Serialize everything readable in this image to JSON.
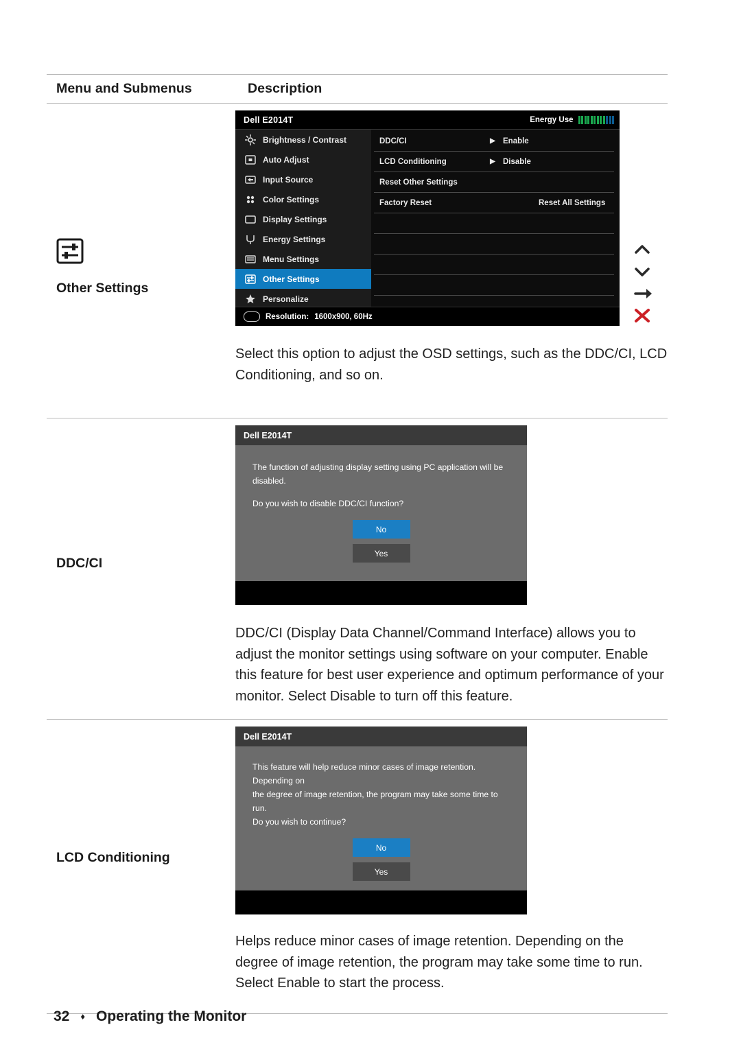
{
  "table": {
    "header": {
      "menu_col": "Menu and Submenus",
      "desc_col": "Description"
    },
    "rows": [
      {
        "label": "Other Settings",
        "description": "Select this option to adjust the OSD settings, such as the DDC/CI, LCD Conditioning, and so on."
      },
      {
        "label": "DDC/CI",
        "description": "DDC/CI (Display Data Channel/Command Interface) allows you to adjust the monitor settings using software on your computer. Enable this feature for best user experience and optimum performance of your monitor. Select Disable to turn off this feature."
      },
      {
        "label": "LCD Conditioning",
        "description": "Helps reduce minor cases of image retention. Depending on the degree of image retention, the program may take some time to run. Select Enable to start the process."
      }
    ]
  },
  "osd": {
    "model": "Dell E2014T",
    "energy_label": "Energy Use",
    "energy_bars_lit": 9,
    "energy_bars_dim": 3,
    "menu_items": [
      {
        "label": "Brightness / Contrast",
        "icon": "brightness-icon",
        "active": false
      },
      {
        "label": "Auto Adjust",
        "icon": "auto-adjust-icon",
        "active": false
      },
      {
        "label": "Input Source",
        "icon": "input-source-icon",
        "active": false
      },
      {
        "label": "Color Settings",
        "icon": "color-settings-icon",
        "active": false
      },
      {
        "label": "Display Settings",
        "icon": "display-settings-icon",
        "active": false
      },
      {
        "label": "Energy Settings",
        "icon": "energy-settings-icon",
        "active": false
      },
      {
        "label": "Menu Settings",
        "icon": "menu-settings-icon",
        "active": false
      },
      {
        "label": "Other Settings",
        "icon": "other-settings-icon",
        "active": true
      },
      {
        "label": "Personalize",
        "icon": "personalize-star-icon",
        "active": false
      }
    ],
    "options": [
      {
        "name": "DDC/CI",
        "arrow": "▶",
        "value": "Enable"
      },
      {
        "name": "LCD Conditioning",
        "arrow": "▶",
        "value": "Disable"
      },
      {
        "name": "Reset Other Settings",
        "arrow": "",
        "value": ""
      },
      {
        "name": "Factory Reset",
        "arrow": "",
        "value": "Reset All Settings"
      }
    ],
    "footer": {
      "resolution_label": "Resolution:",
      "resolution_value": "1600x900, 60Hz"
    },
    "side_buttons": [
      {
        "name": "up-arrow-button",
        "glyph": "∧"
      },
      {
        "name": "down-arrow-button",
        "glyph": "∨"
      },
      {
        "name": "enter-arrow-button",
        "glyph": "→"
      },
      {
        "name": "close-x-button",
        "glyph": "✕"
      }
    ]
  },
  "dialog_ddcci": {
    "title": "Dell E2014T",
    "line1": "The function of adjusting display setting using PC application will be",
    "line2": "disabled.",
    "line3": "Do you wish to disable DDC/CI function?",
    "btn_no": "No",
    "btn_yes": "Yes"
  },
  "dialog_lcd": {
    "title": "Dell E2014T",
    "line1": "This feature will help reduce minor cases of image retention. Depending on",
    "line2": "the degree of image retention, the program may take some time to run.",
    "line3": "Do you wish to continue?",
    "btn_no": "No",
    "btn_yes": "Yes"
  },
  "footer": {
    "page_number": "32",
    "bullet": "♦",
    "section": "Operating the Monitor"
  },
  "colors": {
    "accent_blue": "#0f7bbf",
    "button_blue": "#1b7fc4",
    "dialog_gray": "#6c6c6c",
    "energy_green": "#1aa84f",
    "close_red": "#cc2026"
  }
}
